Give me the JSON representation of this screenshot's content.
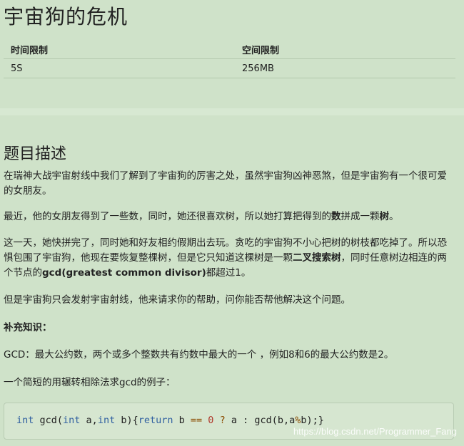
{
  "problem": {
    "title": "宇宙狗的危机",
    "limits": {
      "time_header": "时间限制",
      "space_header": "空间限制",
      "time_value": "5S",
      "space_value": "256MB"
    }
  },
  "description": {
    "heading": "题目描述",
    "p1": "在瑞神大战宇宙射线中我们了解到了宇宙狗的厉害之处，虽然宇宙狗凶神恶煞，但是宇宙狗有一个很可爱的女朋友。",
    "p2_a": "最近，他的女朋友得到了一些数，同时，她还很喜欢树，所以她打算把得到的",
    "p2_b1": "数",
    "p2_c": "拼成一颗",
    "p2_b2": "树",
    "p2_d": "。",
    "p3_a": "这一天，她快拼完了，同时她和好友相约假期出去玩。贪吃的宇宙狗不小心把树的树枝都吃掉了。所以恐惧包围了宇宙狗，他现在要恢复整棵树，但是它只知道这棵树是一颗",
    "p3_b1": "二叉搜索树",
    "p3_c": "，同时任意树边相连的两个节点的",
    "p3_b2": "gcd(greatest common divisor)",
    "p3_d": "都超过1。",
    "p4": "但是宇宙狗只会发射宇宙射线，他来请求你的帮助，问你能否帮他解决这个问题。",
    "supplement_label": "补充知识：",
    "p5": "GCD：最大公约数，两个或多个整数共有约数中最大的一个 ，例如8和6的最大公约数是2。",
    "p6": "一个简短的用辗转相除法求gcd的例子：",
    "code": {
      "t1": "int",
      "t2": " gcd(",
      "t3": "int",
      "t4": " a,",
      "t5": "int",
      "t6": " b){",
      "t7": "return",
      "t8": " b ",
      "t9": "==",
      "t10": " ",
      "t11": "0",
      "t12": " ",
      "t13": "?",
      "t14": " a : gcd(b,a",
      "t15": "%",
      "t16": "b);}"
    }
  },
  "watermark": "https://blog.csdn.net/Programmer_Fang",
  "colors": {
    "background": "#cfe2c9",
    "keyword": "#2f5fa0",
    "number": "#b03a2e"
  }
}
